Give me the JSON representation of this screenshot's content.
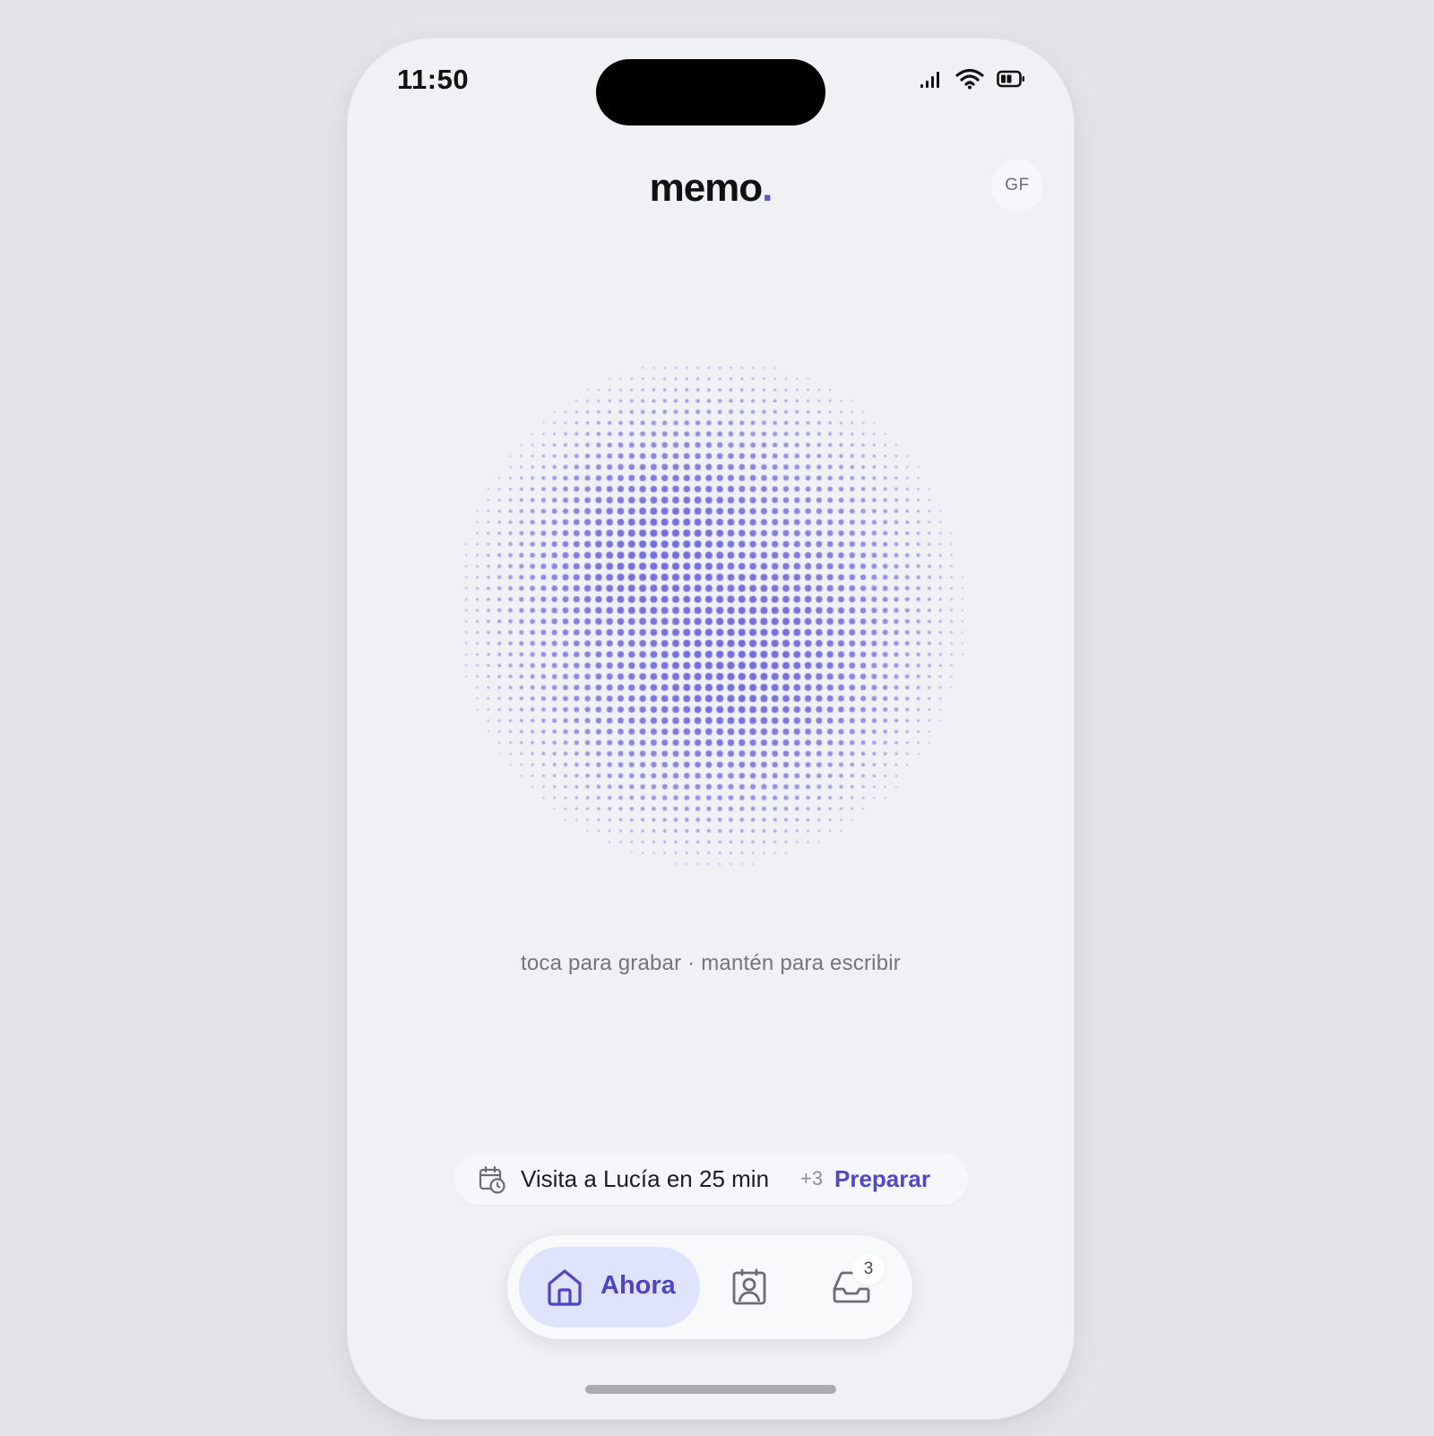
{
  "status_bar": {
    "time": "11:50",
    "icons": [
      "cellular-signal-icon",
      "wifi-icon",
      "battery-icon"
    ]
  },
  "header": {
    "logo_text": "memo",
    "logo_dot": ".",
    "avatar_initials": "GF"
  },
  "recorder": {
    "hint": "toca para grabar · mantén para escribir",
    "accent_color": "#6b65dc"
  },
  "upcoming_event": {
    "icon": "calendar-clock-icon",
    "text": "Visita a Lucía en 25 min",
    "extra_count": "+3",
    "action_label": "Preparar"
  },
  "tab_bar": {
    "tabs": [
      {
        "label": "Ahora",
        "icon": "home-icon",
        "active": true
      },
      {
        "label": "",
        "icon": "contact-card-icon",
        "active": false
      },
      {
        "label": "",
        "icon": "inbox-icon",
        "active": false,
        "badge": "3"
      }
    ]
  },
  "colors": {
    "accent": "#5048c8",
    "background": "#eff1f5",
    "active_tab_bg": "#dfe3fb"
  }
}
